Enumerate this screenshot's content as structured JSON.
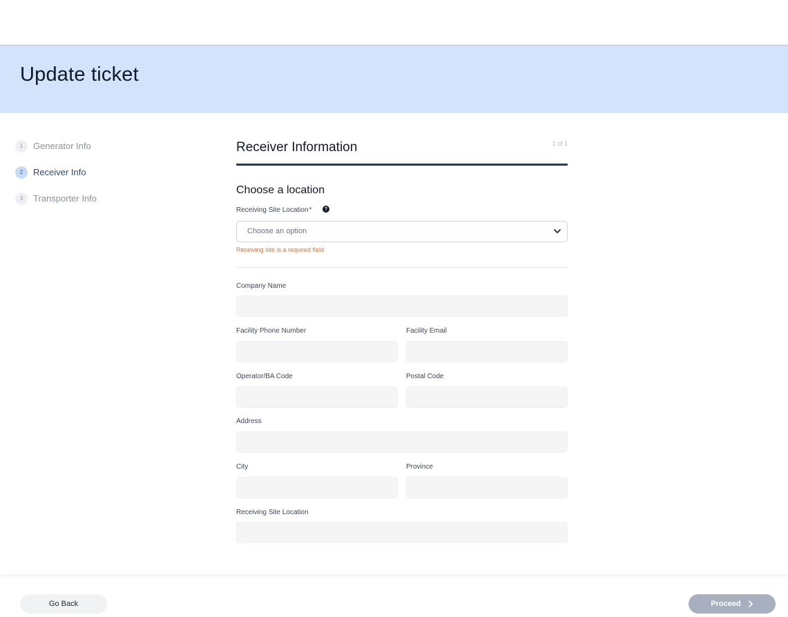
{
  "header": {
    "title": "Update ticket"
  },
  "steps": [
    {
      "number": "1",
      "label": "Generator Info",
      "active": false
    },
    {
      "number": "2",
      "label": "Receiver Info",
      "active": true
    },
    {
      "number": "3",
      "label": "Transporter Info",
      "active": false
    }
  ],
  "form": {
    "title": "Receiver Information",
    "page_count": "1 of 1",
    "section_title": "Choose a location",
    "receiving_site": {
      "label": "Receiving Site Location",
      "required_mark": "*",
      "help_icon": "question-circle-icon",
      "placeholder": "Choose an option",
      "error": "Receiving site is a required field"
    },
    "fields": {
      "company_name": {
        "label": "Company Name",
        "value": ""
      },
      "facility_phone": {
        "label": "Facility Phone Number",
        "value": ""
      },
      "facility_email": {
        "label": "Facility Email",
        "value": ""
      },
      "operator_code": {
        "label": "Operator/BA Code",
        "value": ""
      },
      "postal_code": {
        "label": "Postal Code",
        "value": ""
      },
      "address": {
        "label": "Address",
        "value": ""
      },
      "city": {
        "label": "City",
        "value": ""
      },
      "province": {
        "label": "Province",
        "value": ""
      },
      "receiving_site_location": {
        "label": "Receiving Site Location",
        "value": ""
      }
    }
  },
  "footer": {
    "back_label": "Go Back",
    "proceed_label": "Proceed",
    "proceed_icon": "chevron-right-icon"
  },
  "colors": {
    "hero_bg": "#d3e3fb",
    "accent_rule": "#22386a",
    "error_text": "#c27a4a",
    "proceed_disabled": "#a8b0bf"
  }
}
